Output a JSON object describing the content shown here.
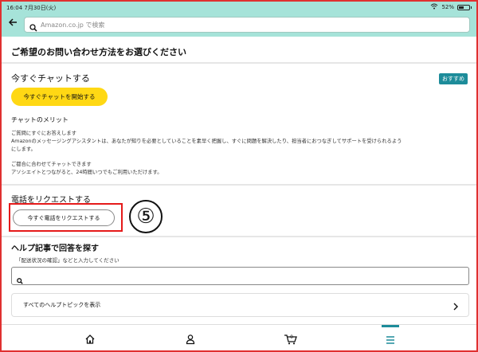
{
  "status_bar": {
    "time_date": "16:04  7月30日(火)",
    "battery": "52%",
    "battery_level": 0.52
  },
  "search": {
    "placeholder": "Amazon.co.jp で検索"
  },
  "page": {
    "title": "ご希望のお問い合わせ方法をお選びください"
  },
  "chat": {
    "heading": "今すぐチャットする",
    "badge": "おすすめ",
    "button_label": "今すぐチャットを開始する",
    "merits_heading": "チャットのメリット",
    "merit1_title": "ご質問にすぐにお答えします",
    "merit1_body_line1": "Amazonのメッセージングアシスタントは、あなたが知りを必要としていることを素早く把握し、すぐに問題を解決したり、担当者におつなぎしてサポートを受けられるよう",
    "merit1_body_line2": "にします。",
    "merit2_title": "ご都合に合わせてチャットできます",
    "merit2_body": "アソシエイトとつながると、24時間いつでもご利用いただけます。"
  },
  "phone": {
    "heading": "電話をリクエストする",
    "button_label": "今すぐ電話をリクエストする",
    "step_marker": "⑤"
  },
  "help": {
    "heading": "ヘルプ記事で回答を探す",
    "sub": "「配送状況の確認」などと入力してください",
    "input_value": "",
    "topics_label": "すべてのヘルプトピックを表示"
  },
  "tabbar": {
    "tabs": [
      {
        "name": "home",
        "icon": "home-icon"
      },
      {
        "name": "account",
        "icon": "person-icon"
      },
      {
        "name": "cart",
        "icon": "cart-icon",
        "badge": "0"
      },
      {
        "name": "menu",
        "icon": "menu-icon",
        "active": true
      }
    ]
  },
  "colors": {
    "header_bg": "#a6e3d9",
    "chat_button": "#ffd814",
    "accent": "#1d8c9a",
    "annotation": "#e51a1a"
  }
}
